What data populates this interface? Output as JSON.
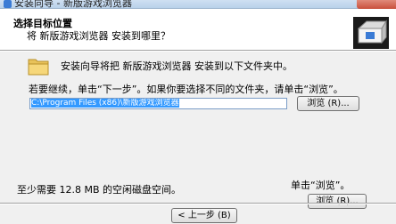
{
  "window": {
    "title": "安装向导 - 新版游戏浏览器"
  },
  "header": {
    "title": "选择目标位置",
    "subtitle": "将 新版游戏浏览器 安装到哪里？",
    "icon": "installer-box-icon"
  },
  "content": {
    "folder_icon": "folder-icon",
    "intro_text": "安装向导将把 新版游戏浏览器 安装到以下文件夹中。",
    "instruction_text": "若要继续，单击“下一步”。如果你要选择不同的文件夹，请单击“浏览”。",
    "path_value": "C:\\Program Files (x86)\\新版游戏浏览器",
    "browse_button": "浏览 (R)...",
    "browse_hint": "单击“浏览”。",
    "browse_button_2": "浏览 (R)...",
    "space_note": "至少需要 12.8 MB 的空闲磁盘空间。"
  },
  "footer": {
    "back_button": "< 上一步 (B)"
  }
}
